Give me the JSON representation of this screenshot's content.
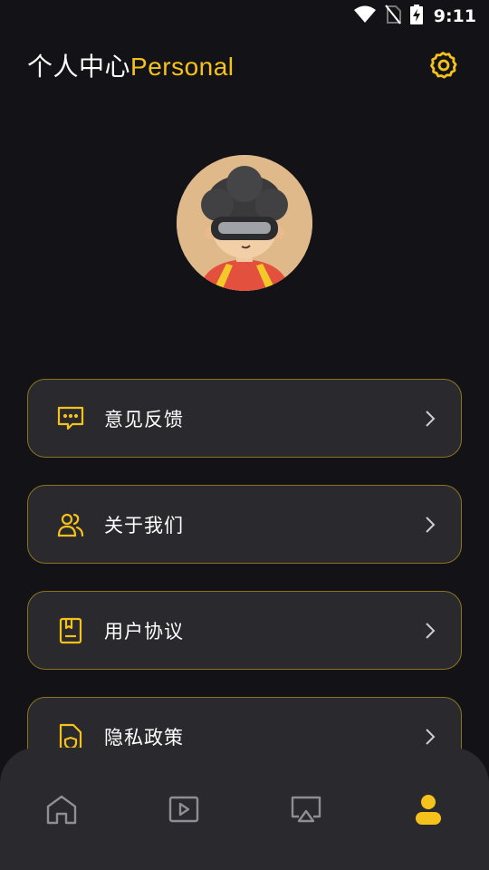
{
  "status_bar": {
    "time": "9:11",
    "icons": [
      "wifi-icon",
      "no-sim-icon",
      "battery-charging-icon"
    ]
  },
  "header": {
    "title_cn": "个人中心",
    "title_en": "Personal",
    "settings_icon": "gear-icon"
  },
  "colors": {
    "background": "#131216",
    "card": "#2a292e",
    "accent": "#f5c21b",
    "border": "#8a7420"
  },
  "menu": {
    "items": [
      {
        "label": "意见反馈",
        "icon": "chat-bubble-icon"
      },
      {
        "label": "关于我们",
        "icon": "users-icon"
      },
      {
        "label": "用户协议",
        "icon": "document-icon"
      },
      {
        "label": "隐私政策",
        "icon": "privacy-file-icon"
      }
    ]
  },
  "bottom_nav": {
    "items": [
      {
        "icon": "home-icon",
        "active": false
      },
      {
        "icon": "play-icon",
        "active": false
      },
      {
        "icon": "cast-icon",
        "active": false
      },
      {
        "icon": "user-icon",
        "active": true
      }
    ]
  }
}
